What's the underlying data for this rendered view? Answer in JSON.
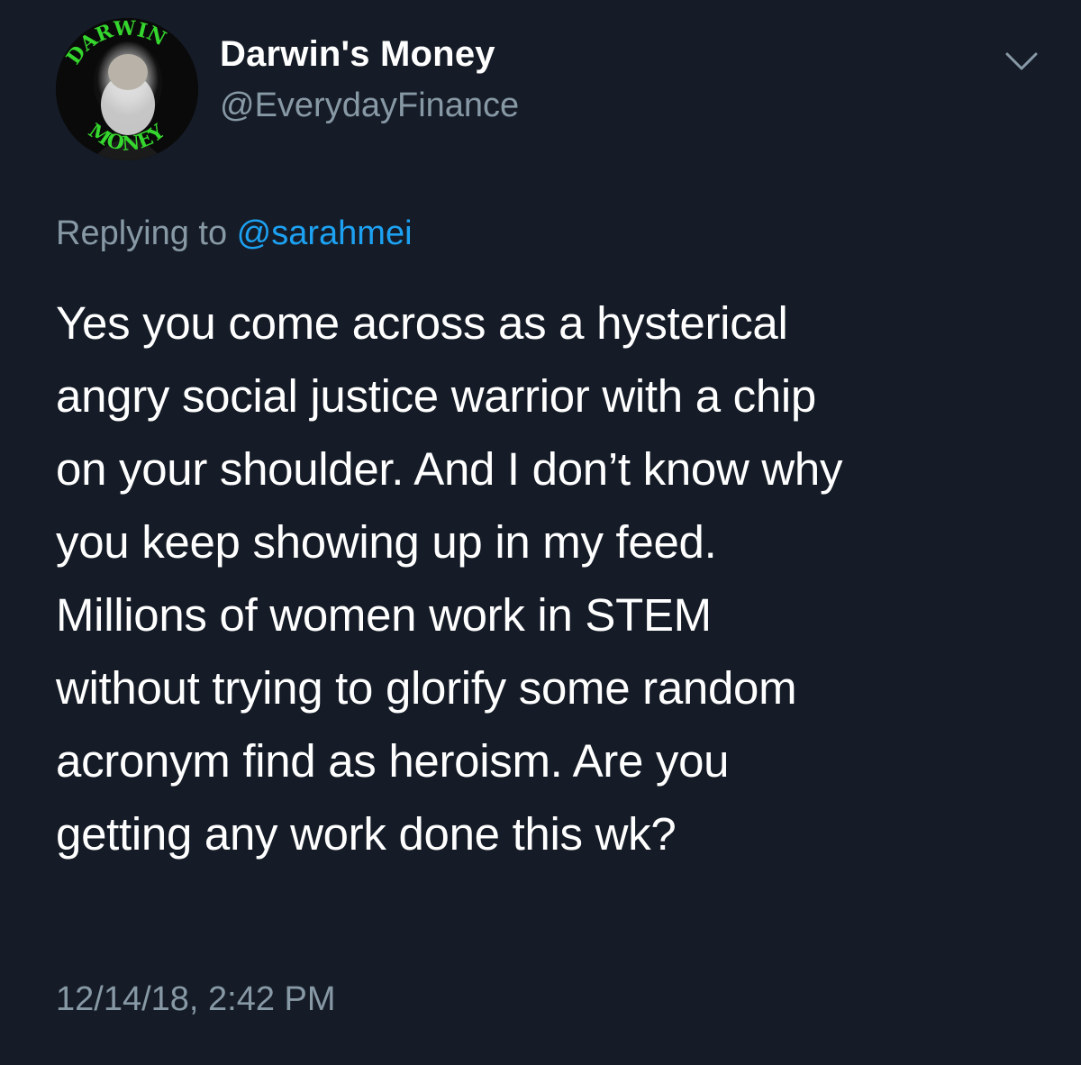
{
  "author": {
    "display_name": "Darwin's Money",
    "handle": "@EverydayFinance",
    "avatar_text_top": "DARWIN",
    "avatar_text_bottom": "MONEY"
  },
  "reply": {
    "prefix": "Replying to ",
    "mention": "@sarahmei"
  },
  "tweet": {
    "lines": [
      "Yes you come across as a hysterical",
      "angry social justice warrior with a chip",
      "on your shoulder. And I don’t know why",
      "you keep showing up in my feed.",
      "Millions of women work in STEM",
      "without trying to glorify some random",
      "acronym find as heroism. Are you",
      "getting any work done this wk?"
    ]
  },
  "timestamp": "12/14/18, 2:42 PM",
  "icons": {
    "menu": "chevron-down-icon"
  },
  "colors": {
    "background": "#151c27",
    "primary_text": "#ffffff",
    "secondary_text": "#8899a6",
    "link": "#1da1f2",
    "avatar_lettering": "#35d62e"
  }
}
